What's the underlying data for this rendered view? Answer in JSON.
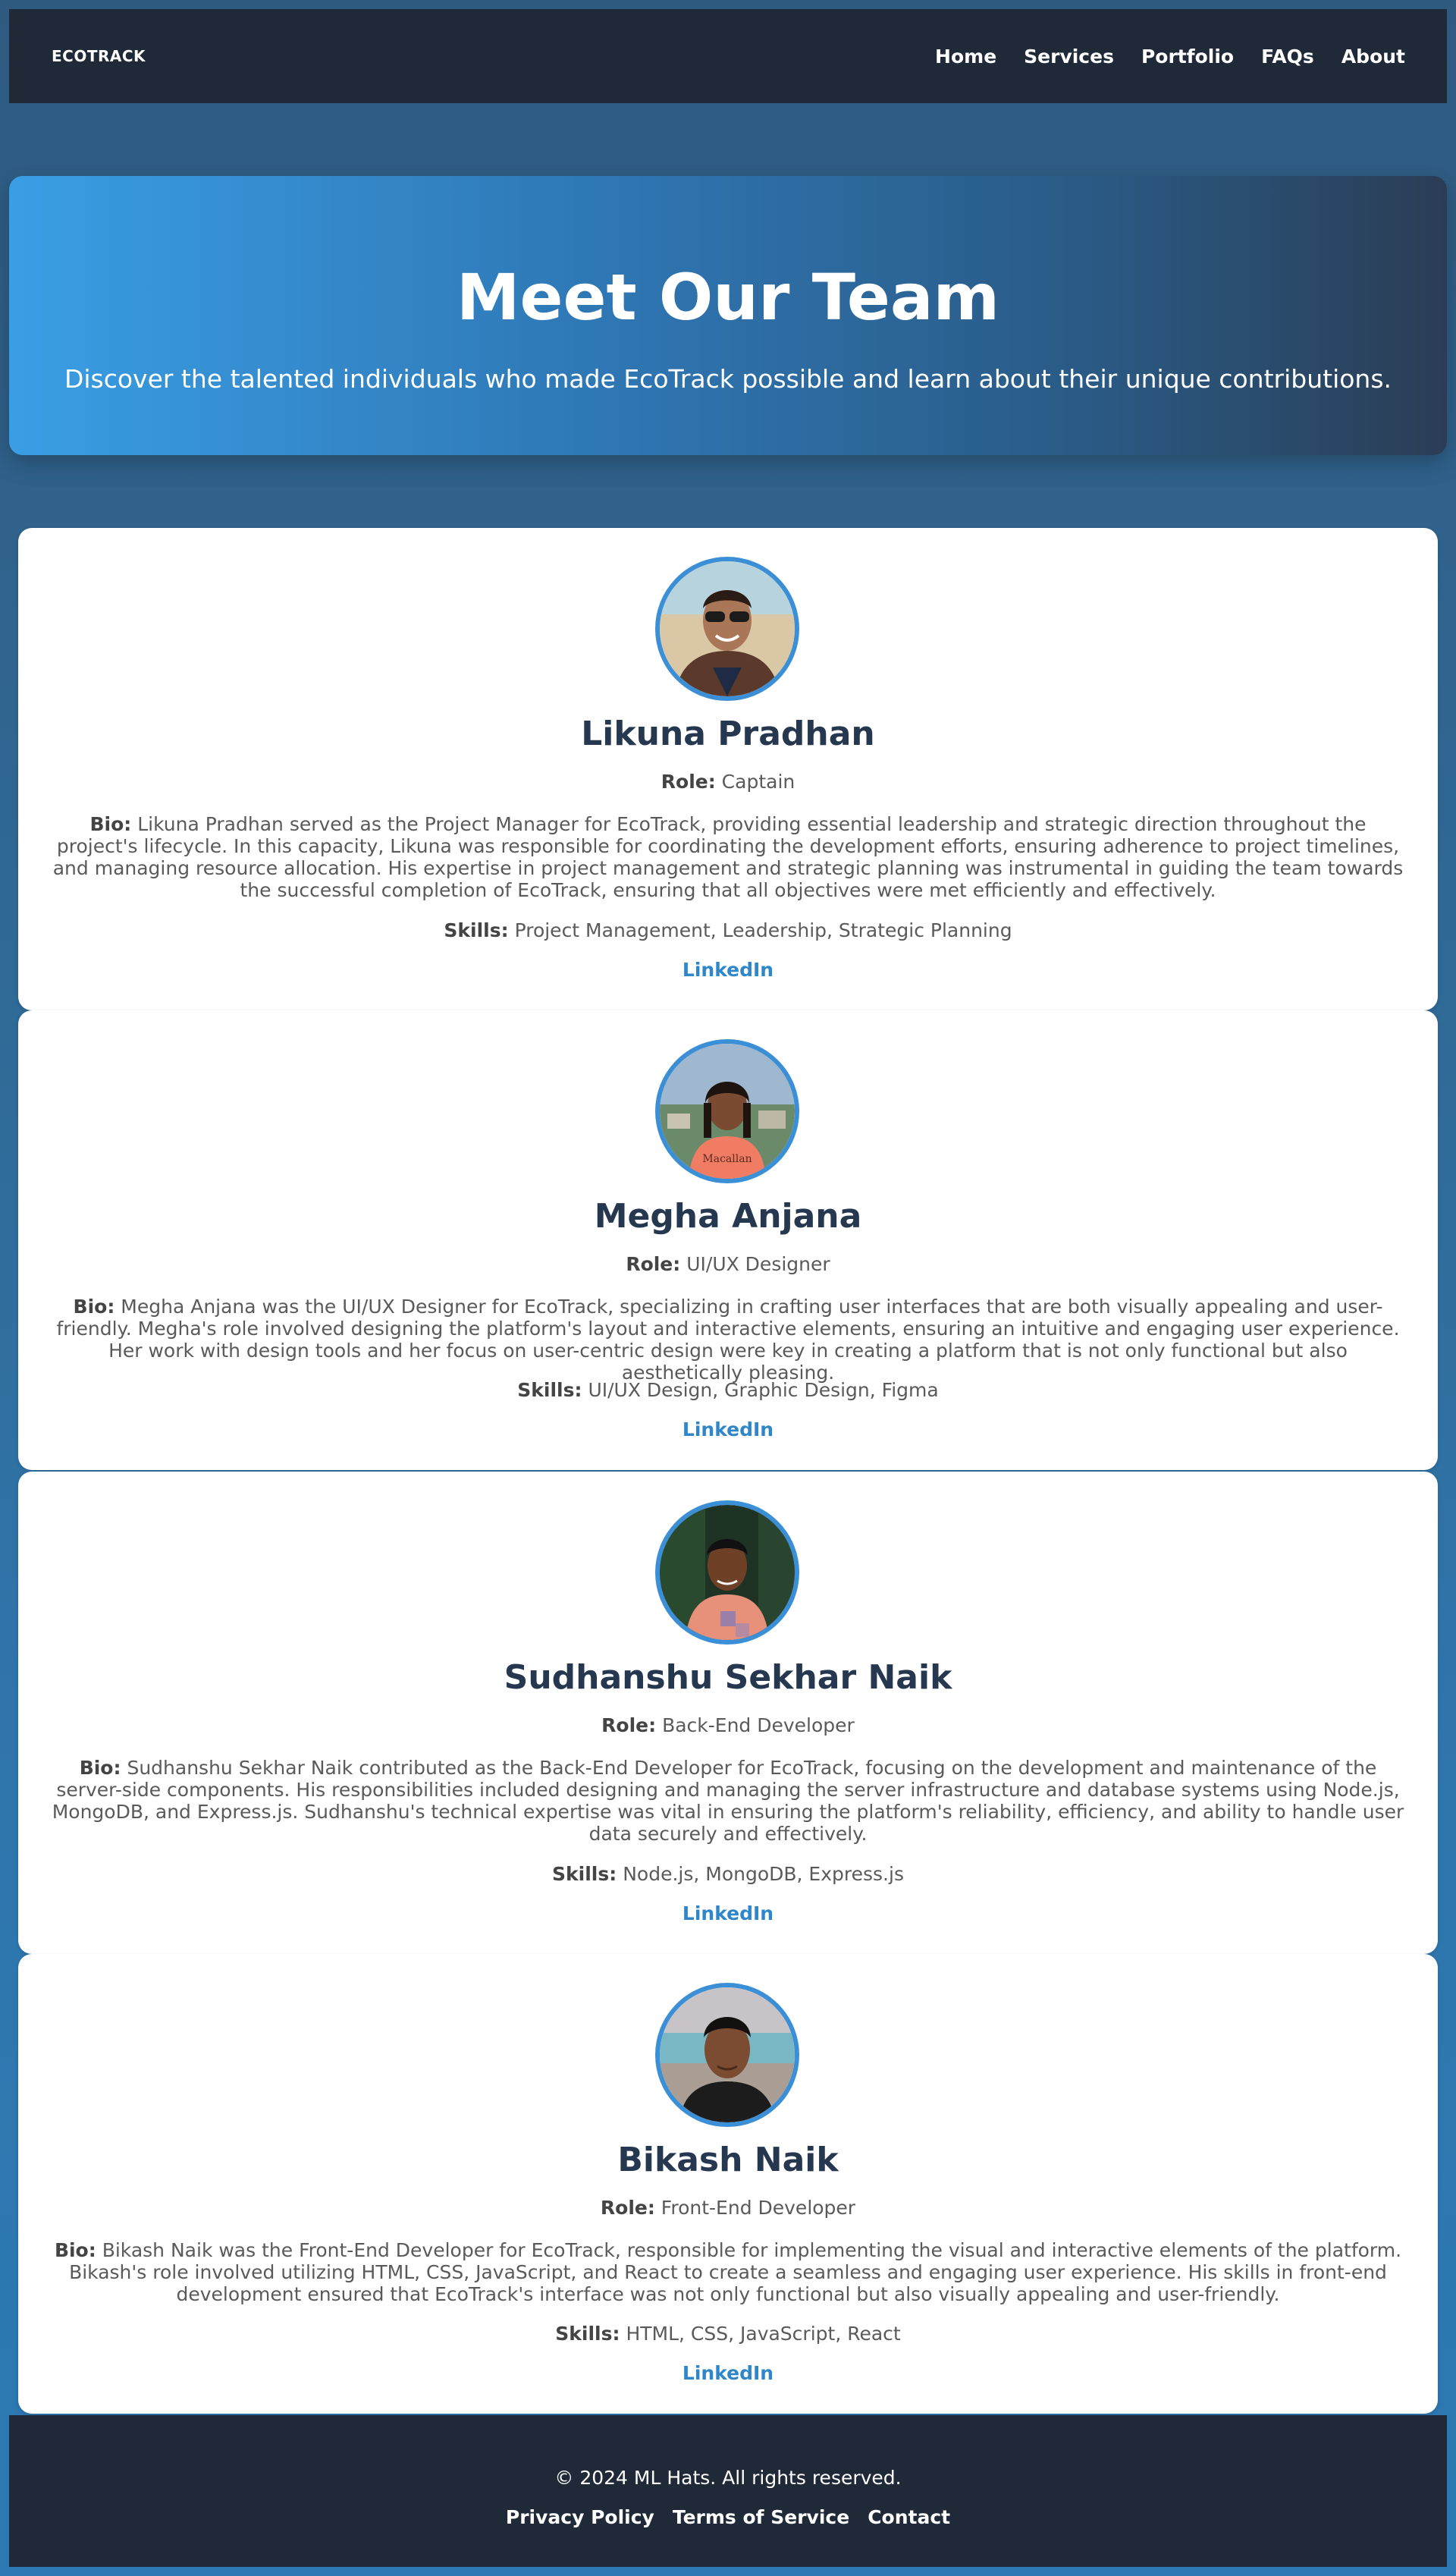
{
  "navbar": {
    "logo": "ECOTRACK",
    "links": [
      "Home",
      "Services",
      "Portfolio",
      "FAQs",
      "About"
    ]
  },
  "hero": {
    "title": "Meet Our Team",
    "subtitle": "Discover the talented individuals who made EcoTrack possible and learn about their unique contributions."
  },
  "labels": {
    "role": "Role:",
    "bio": "Bio:",
    "skills": "Skills:"
  },
  "team": [
    {
      "name": "Likuna Pradhan",
      "role": "Captain",
      "bio": "Likuna Pradhan served as the Project Manager for EcoTrack, providing essential leadership and strategic direction throughout the project's lifecycle. In this capacity, Likuna was responsible for coordinating the development efforts, ensuring adherence to project timelines, and managing resource allocation. His expertise in project management and strategic planning was instrumental in guiding the team towards the successful completion of EcoTrack, ensuring that all objectives were met efficiently and effectively.",
      "skills": "Project Management, Leadership, Strategic Planning",
      "link": "LinkedIn"
    },
    {
      "name": "Megha Anjana",
      "role": "UI/UX Designer",
      "bio": "Megha Anjana was the UI/UX Designer for EcoTrack, specializing in crafting user interfaces that are both visually appealing and user-friendly. Megha's role involved designing the platform's layout and interactive elements, ensuring an intuitive and engaging user experience. Her work with design tools and her focus on user-centric design were key in creating a platform that is not only functional but also aesthetically pleasing.",
      "skills": "UI/UX Design, Graphic Design, Figma",
      "link": "LinkedIn"
    },
    {
      "name": "Sudhanshu Sekhar Naik",
      "role": "Back-End Developer",
      "bio": "Sudhanshu Sekhar Naik contributed as the Back-End Developer for EcoTrack, focusing on the development and maintenance of the server-side components. His responsibilities included designing and managing the server infrastructure and database systems using Node.js, MongoDB, and Express.js. Sudhanshu's technical expertise was vital in ensuring the platform's reliability, efficiency, and ability to handle user data securely and effectively.",
      "skills": "Node.js, MongoDB, Express.js",
      "link": "LinkedIn"
    },
    {
      "name": "Bikash Naik",
      "role": "Front-End Developer",
      "bio": "Bikash Naik was the Front-End Developer for EcoTrack, responsible for implementing the visual and interactive elements of the platform. Bikash's role involved utilizing HTML, CSS, JavaScript, and React to create a seamless and engaging user experience. His skills in front-end development ensured that EcoTrack's interface was not only functional but also visually appealing and user-friendly.",
      "skills": "HTML, CSS, JavaScript, React",
      "link": "LinkedIn"
    }
  ],
  "footer": {
    "copyright": "© 2024 ML Hats. All rights reserved.",
    "links": [
      "Privacy Policy",
      "Terms of Service",
      "Contact"
    ]
  },
  "colors": {
    "nav_bg": "#1f2937",
    "accent": "#3b8fd6",
    "name_color": "#26384f"
  }
}
